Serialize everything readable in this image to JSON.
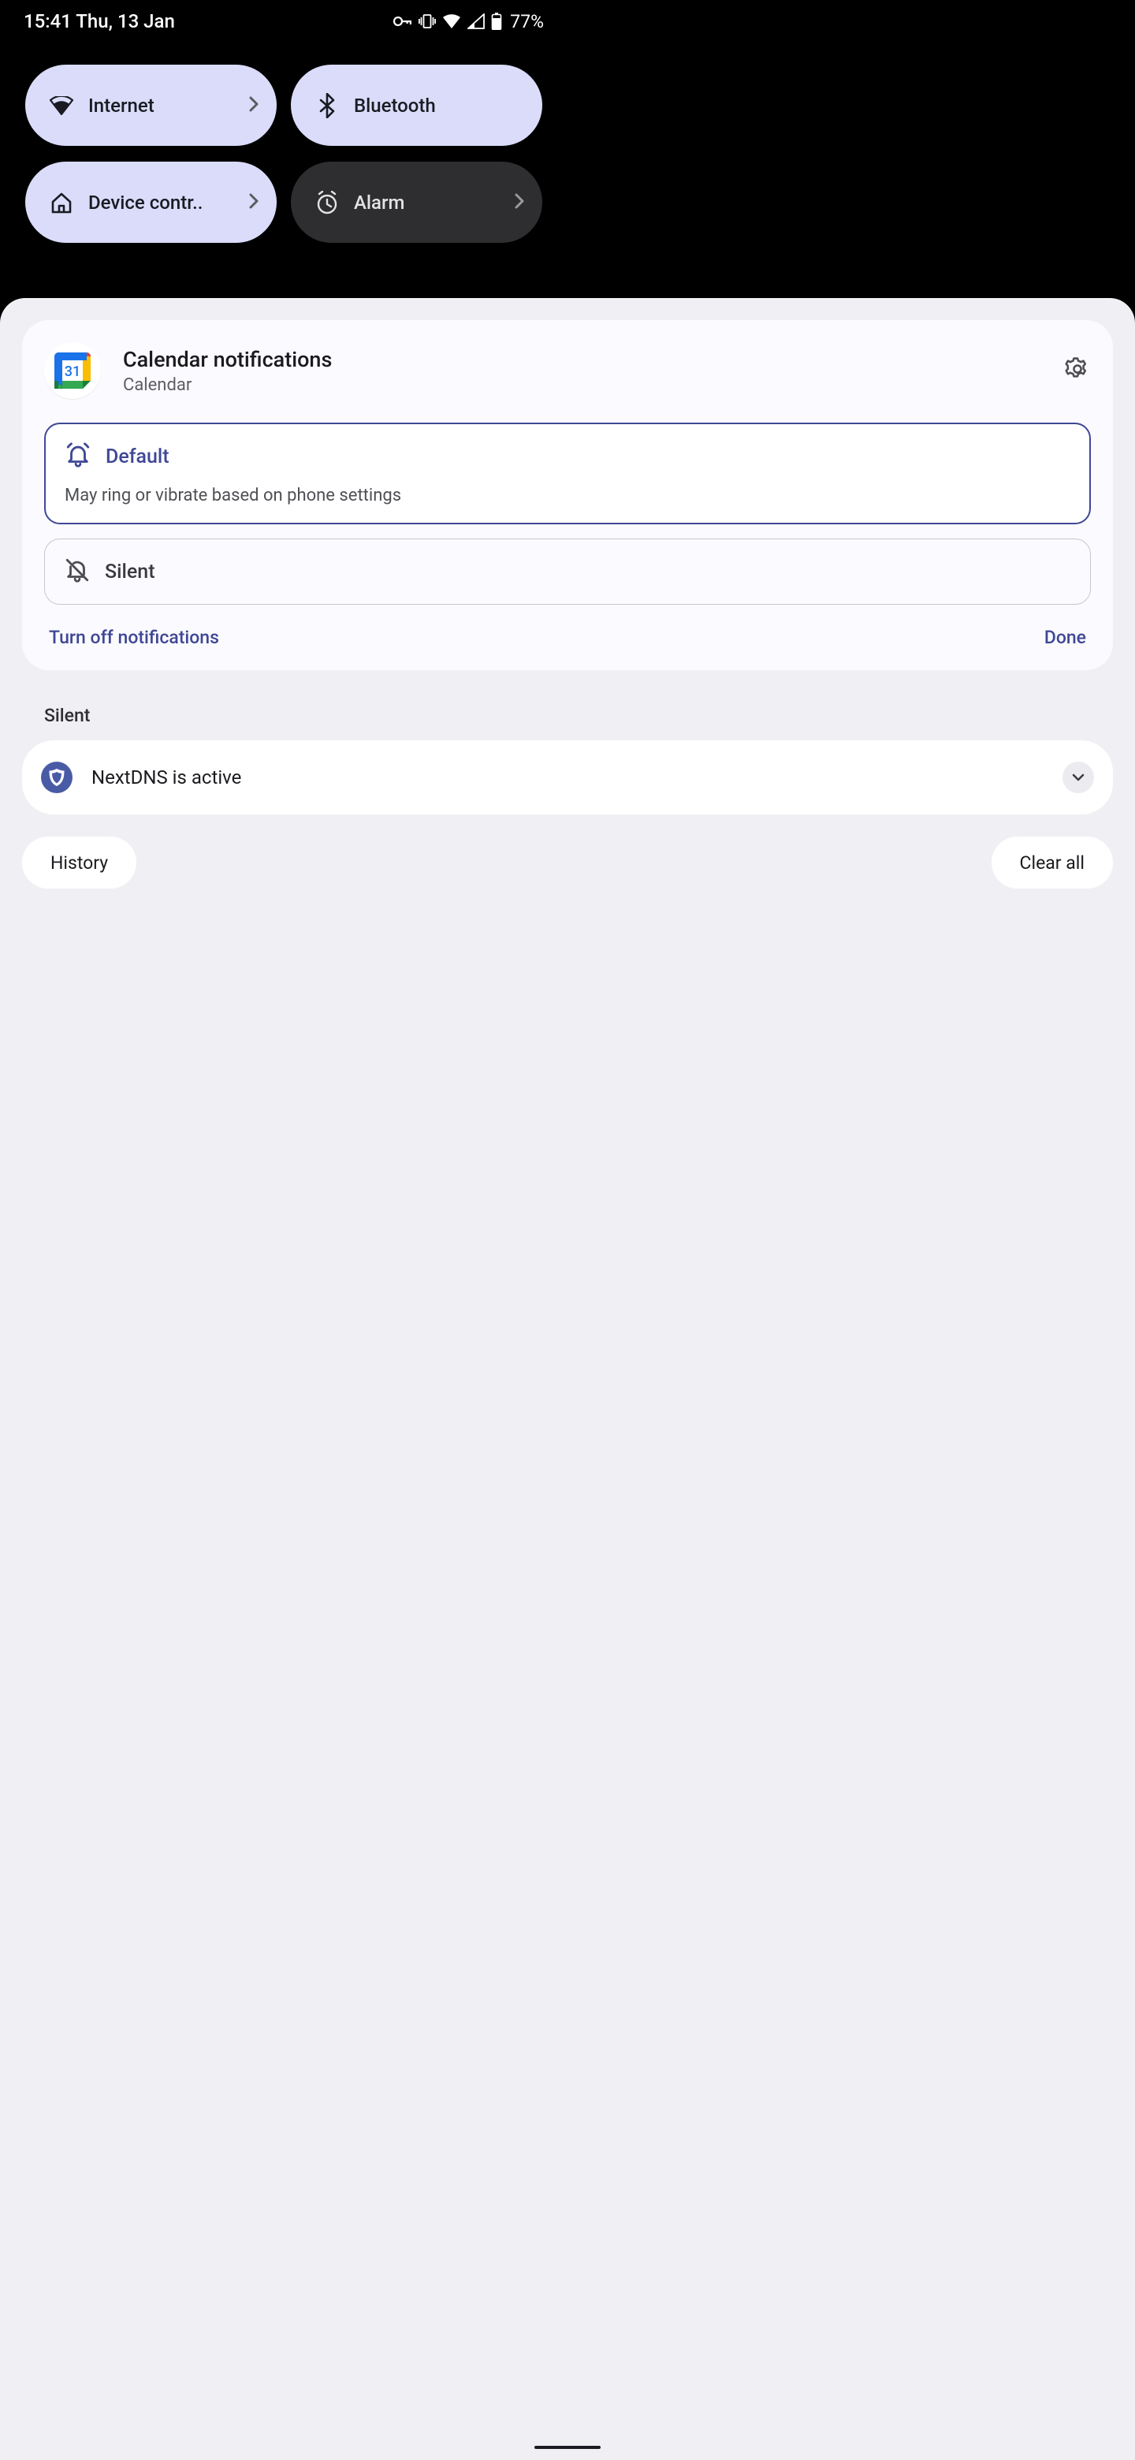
{
  "status": {
    "time_date": "15:41 Thu, 13 Jan",
    "battery": "77%"
  },
  "qs": {
    "tiles": [
      {
        "label": "Internet",
        "active": true,
        "chevron": true,
        "icon": "wifi"
      },
      {
        "label": "Bluetooth",
        "active": true,
        "chevron": false,
        "icon": "bluetooth"
      },
      {
        "label": "Device contr..",
        "active": true,
        "chevron": true,
        "icon": "home"
      },
      {
        "label": "Alarm",
        "active": false,
        "chevron": true,
        "icon": "alarm"
      }
    ]
  },
  "notif_card": {
    "title": "Calendar notifications",
    "subtitle": "Calendar",
    "app_icon_day": "31",
    "options": [
      {
        "label": "Default",
        "desc": "May ring or vibrate based on phone settings",
        "selected": true
      },
      {
        "label": "Silent",
        "desc": "",
        "selected": false
      }
    ],
    "turn_off": "Turn off notifications",
    "done": "Done"
  },
  "silent_section": {
    "heading": "Silent",
    "item": "NextDNS is active"
  },
  "bottom": {
    "history": "History",
    "clear": "Clear all"
  }
}
